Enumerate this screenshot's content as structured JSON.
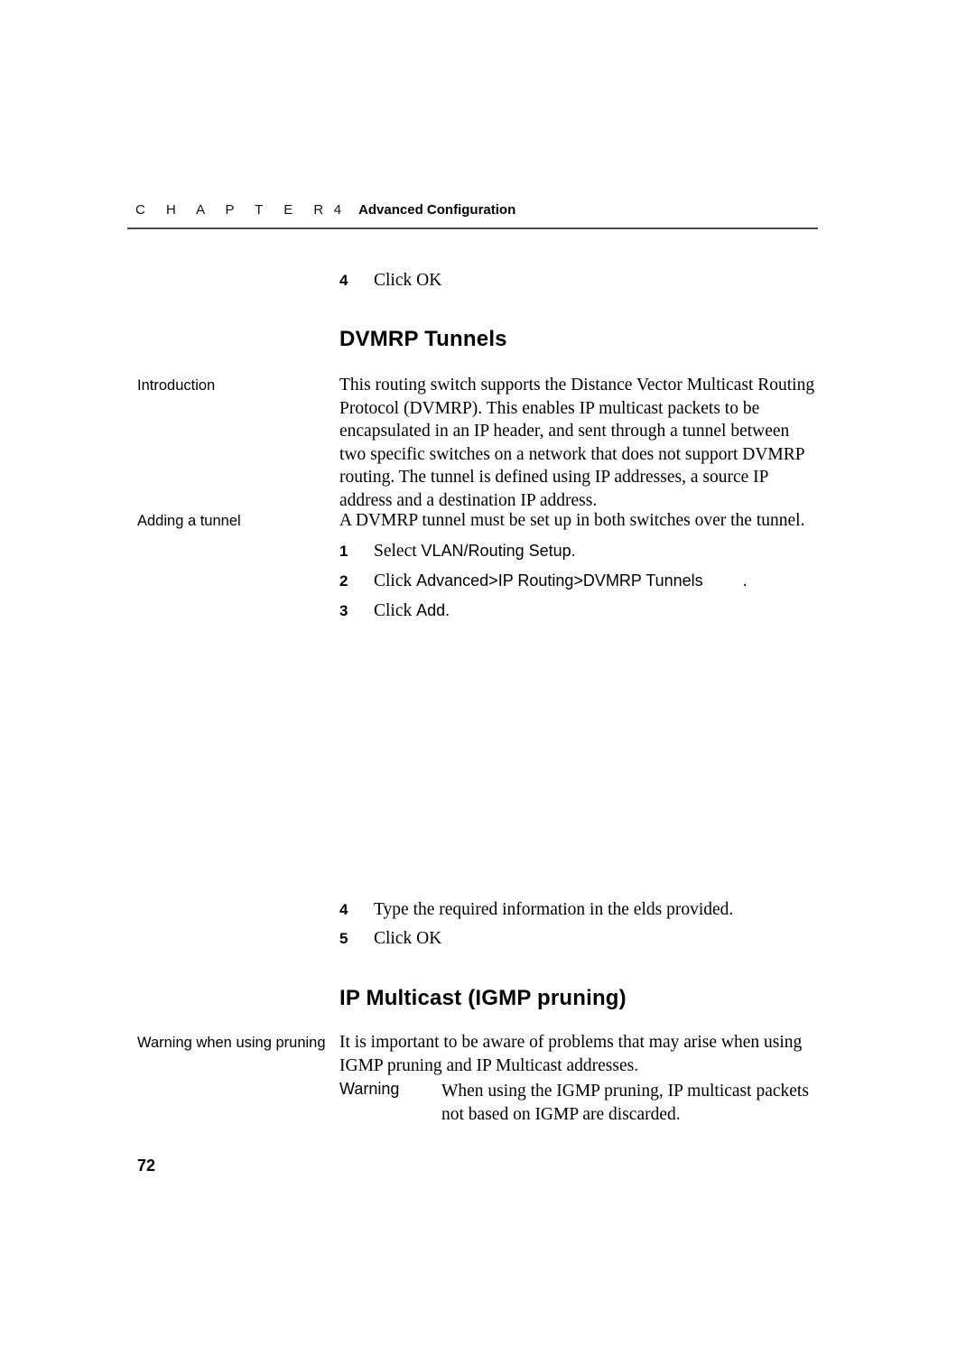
{
  "header": {
    "chapter_word": "C H A P T E R",
    "chapter_number": "4",
    "chapter_title": "Advanced Configuration"
  },
  "top_step": {
    "number": "4",
    "text": "Click OK"
  },
  "sections": [
    {
      "heading": "DVMRP Tunnels",
      "blocks": [
        {
          "label": "Introduction",
          "paragraph": "This routing switch supports the Distance Vector Multicast Routing Protocol (DVMRP). This enables IP multicast packets to be encapsulated in an IP header, and sent through a tunnel between two specific switches on a network that does not support DVMRP routing. The tunnel is defined using IP addresses, a source IP address and a destination IP address."
        },
        {
          "label": "Adding a tunnel",
          "paragraph": "A DVMRP tunnel must be set up in both switches over the tunnel."
        }
      ],
      "steps": [
        {
          "number": "1",
          "lead": "Select ",
          "ui": "VLAN/Routing Setup.",
          "trailing": ""
        },
        {
          "number": "2",
          "lead": "Click ",
          "ui": "Advanced>IP Routing>DVMRP Tunnels",
          "trailing": "."
        },
        {
          "number": "3",
          "lead": "Click ",
          "ui": "Add.",
          "trailing": ""
        },
        {
          "number": "4",
          "lead": "Type the required information in the  elds provided.",
          "ui": "",
          "trailing": ""
        },
        {
          "number": "5",
          "lead": "Click OK",
          "ui": "",
          "trailing": ""
        }
      ]
    },
    {
      "heading": "IP Multicast (IGMP pruning)",
      "blocks": [
        {
          "label": "Warning when using pruning",
          "paragraph": "It is important to be aware of problems that may arise when using IGMP pruning and IP Multicast addresses."
        }
      ],
      "warning": {
        "label": "Warning",
        "text": "When using the IGMP pruning, IP multicast packets not based on IGMP are discarded."
      }
    }
  ],
  "folio": "72"
}
